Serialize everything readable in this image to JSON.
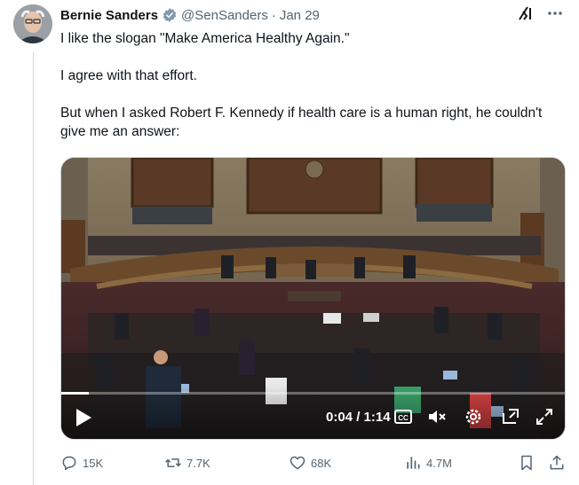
{
  "post": {
    "author_name": "Bernie Sanders",
    "handle": "@SenSanders",
    "separator": "·",
    "date": "Jan 29",
    "paragraphs": [
      "I like the slogan \"Make America Healthy Again.\"",
      "I agree with that effort.",
      "But when I asked Robert F. Kennedy if health care is a human right, he couldn't give me an answer:"
    ]
  },
  "video": {
    "time_display": "0:04 / 1:14",
    "progress_fraction": 0.054,
    "controls": [
      "play-icon",
      "captions-icon",
      "mute-icon",
      "settings-icon",
      "pip-icon",
      "fullscreen-icon"
    ]
  },
  "actions": {
    "replies": "15K",
    "reposts": "7.7K",
    "likes": "68K",
    "views": "4.7M"
  },
  "icons": [
    "grok-icon",
    "more-icon",
    "verified-badge-icon",
    "reply-icon",
    "repost-icon",
    "like-icon",
    "views-icon",
    "bookmark-icon",
    "share-icon"
  ],
  "colors": {
    "text": "#0f1419",
    "secondary": "#536471",
    "verified": "#829aab",
    "divider": "#cfd9de"
  }
}
